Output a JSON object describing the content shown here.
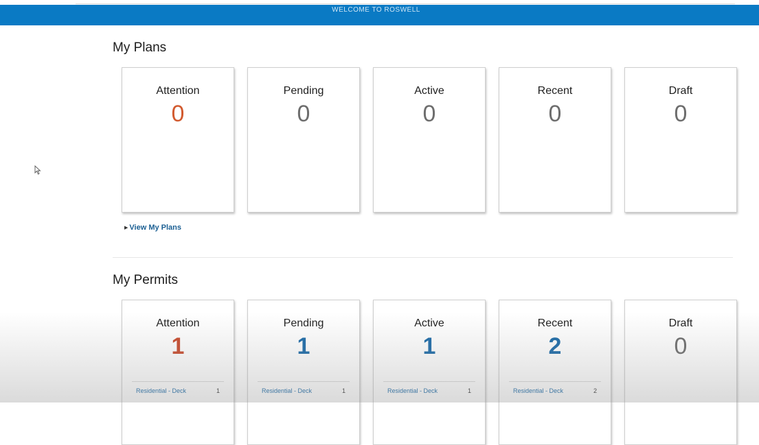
{
  "banner": {
    "text": "WELCOME TO ROSWELL",
    "color": "#0a7ac4"
  },
  "plans": {
    "title": "My Plans",
    "cards": [
      {
        "label": "Attention",
        "count": "0"
      },
      {
        "label": "Pending",
        "count": "0"
      },
      {
        "label": "Active",
        "count": "0"
      },
      {
        "label": "Recent",
        "count": "0"
      },
      {
        "label": "Draft",
        "count": "0"
      }
    ],
    "view_link": "View My Plans"
  },
  "permits": {
    "title": "My Permits",
    "cards": [
      {
        "label": "Attention",
        "count": "1",
        "items": [
          {
            "name": "Residential - Deck",
            "num": "1"
          }
        ]
      },
      {
        "label": "Pending",
        "count": "1",
        "items": [
          {
            "name": "Residential - Deck",
            "num": "1"
          }
        ]
      },
      {
        "label": "Active",
        "count": "1",
        "items": [
          {
            "name": "Residential - Deck",
            "num": "1"
          }
        ]
      },
      {
        "label": "Recent",
        "count": "2",
        "items": [
          {
            "name": "Residential - Deck",
            "num": "2"
          }
        ]
      },
      {
        "label": "Draft",
        "count": "0"
      }
    ]
  },
  "colors": {
    "attention": "#d25a2f",
    "count_blue": "#1b6aa8",
    "count_gray": "#6d6d6d"
  }
}
